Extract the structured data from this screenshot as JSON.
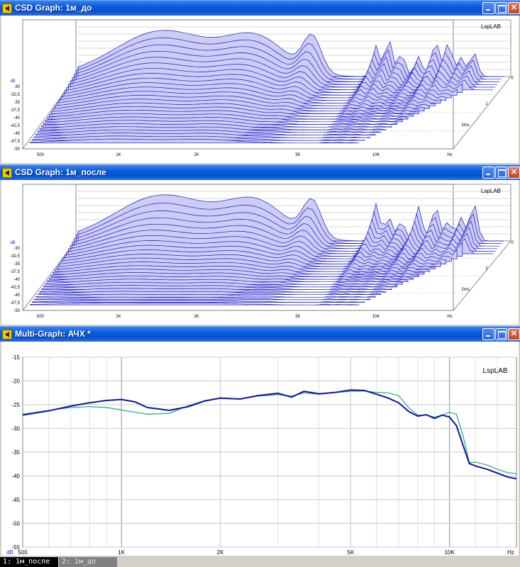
{
  "windows": [
    {
      "id": "csd1",
      "title": "CSD Graph: 1м_до",
      "logo": "LspLAB",
      "ylabel": "dB",
      "yticks": [
        "-30",
        "-32,5",
        "-35",
        "-37,5",
        "-40",
        "-42,5",
        "-45",
        "-47,5",
        "-50"
      ],
      "xticks": [
        "500",
        "1K",
        "2K",
        "5K",
        "10K",
        "Hz"
      ],
      "zticks": [
        "0",
        "1",
        "2ms"
      ]
    },
    {
      "id": "csd2",
      "title": "CSD Graph: 1м_после",
      "logo": "LspLAB",
      "ylabel": "dB",
      "yticks": [
        "-30",
        "-32,5",
        "-35",
        "-37,5",
        "-40",
        "-42,5",
        "-45",
        "-47,5",
        "-50"
      ],
      "xticks": [
        "500",
        "1K",
        "2K",
        "5K",
        "10K",
        "Hz"
      ],
      "zticks": [
        "0",
        "1",
        "2ms"
      ]
    }
  ],
  "multigraph": {
    "title": "Multi-Graph: АЧХ *",
    "logo": "LspLAB",
    "tabs": [
      {
        "label": "1: 1м_после",
        "active": true
      },
      {
        "label": "2: 1м_до",
        "active": false
      }
    ]
  },
  "colors": {
    "csd_line": "#1a1acc",
    "csd_fill": "#ccccf4",
    "series1": "#1515a0",
    "series2": "#20a890",
    "grid": "#c8c8c8"
  },
  "chart_data": [
    {
      "type": "line",
      "ylabel": "dB",
      "xscale": "log",
      "xlim": [
        500,
        16000
      ],
      "ylim": [
        -55,
        -15
      ],
      "xticks": [
        {
          "v": 500,
          "label": "500"
        },
        {
          "v": 1000,
          "label": "1K"
        },
        {
          "v": 2000,
          "label": "2K"
        },
        {
          "v": 5000,
          "label": "5K"
        },
        {
          "v": 10000,
          "label": "10K"
        },
        {
          "v": 15000,
          "label": "Hz"
        }
      ],
      "yticks": [
        -15,
        -20,
        -25,
        -30,
        -35,
        -40,
        -45,
        -50,
        -55
      ],
      "grid": true,
      "series": [
        {
          "name": "1: 1м_после",
          "x": [
            500,
            600,
            700,
            800,
            900,
            1000,
            1100,
            1200,
            1400,
            1600,
            1800,
            2000,
            2300,
            2600,
            3000,
            3300,
            3600,
            4000,
            4500,
            5000,
            5500,
            6000,
            6500,
            7000,
            7500,
            8000,
            8500,
            9000,
            9500,
            10000,
            10500,
            11000,
            11500,
            12000,
            13000,
            14000,
            15000,
            16000
          ],
          "y": [
            -27.2,
            -26.3,
            -25.3,
            -24.6,
            -24.1,
            -23.9,
            -24.4,
            -25.6,
            -26.2,
            -25.4,
            -24.2,
            -23.6,
            -23.8,
            -23.1,
            -22.6,
            -23.4,
            -22.2,
            -22.7,
            -22.4,
            -21.9,
            -22.0,
            -22.8,
            -23.6,
            -24.6,
            -26.4,
            -27.4,
            -27.1,
            -27.9,
            -27.2,
            -27.6,
            -29.4,
            -33.6,
            -37.4,
            -37.9,
            -38.6,
            -39.4,
            -40.2,
            -40.6
          ]
        },
        {
          "name": "2: 1м_до",
          "x": [
            500,
            600,
            700,
            800,
            900,
            1000,
            1100,
            1200,
            1400,
            1600,
            1800,
            2000,
            2300,
            2600,
            3000,
            3300,
            3600,
            4000,
            4500,
            5000,
            5500,
            6000,
            6500,
            7000,
            7500,
            8000,
            8500,
            9000,
            9500,
            10000,
            10500,
            11000,
            11500,
            12000,
            13000,
            14000,
            15000,
            16000
          ],
          "y": [
            -27.0,
            -26.2,
            -25.6,
            -25.4,
            -25.6,
            -26.1,
            -26.6,
            -27.0,
            -26.8,
            -25.2,
            -24.1,
            -23.7,
            -23.8,
            -23.2,
            -22.9,
            -23.2,
            -22.5,
            -22.8,
            -22.4,
            -22.2,
            -22.1,
            -22.4,
            -22.5,
            -23.1,
            -25.6,
            -27.2,
            -27.2,
            -27.6,
            -27.2,
            -26.6,
            -27.0,
            -31.6,
            -37.2,
            -37.1,
            -37.7,
            -38.6,
            -39.3,
            -39.5
          ]
        }
      ]
    }
  ]
}
